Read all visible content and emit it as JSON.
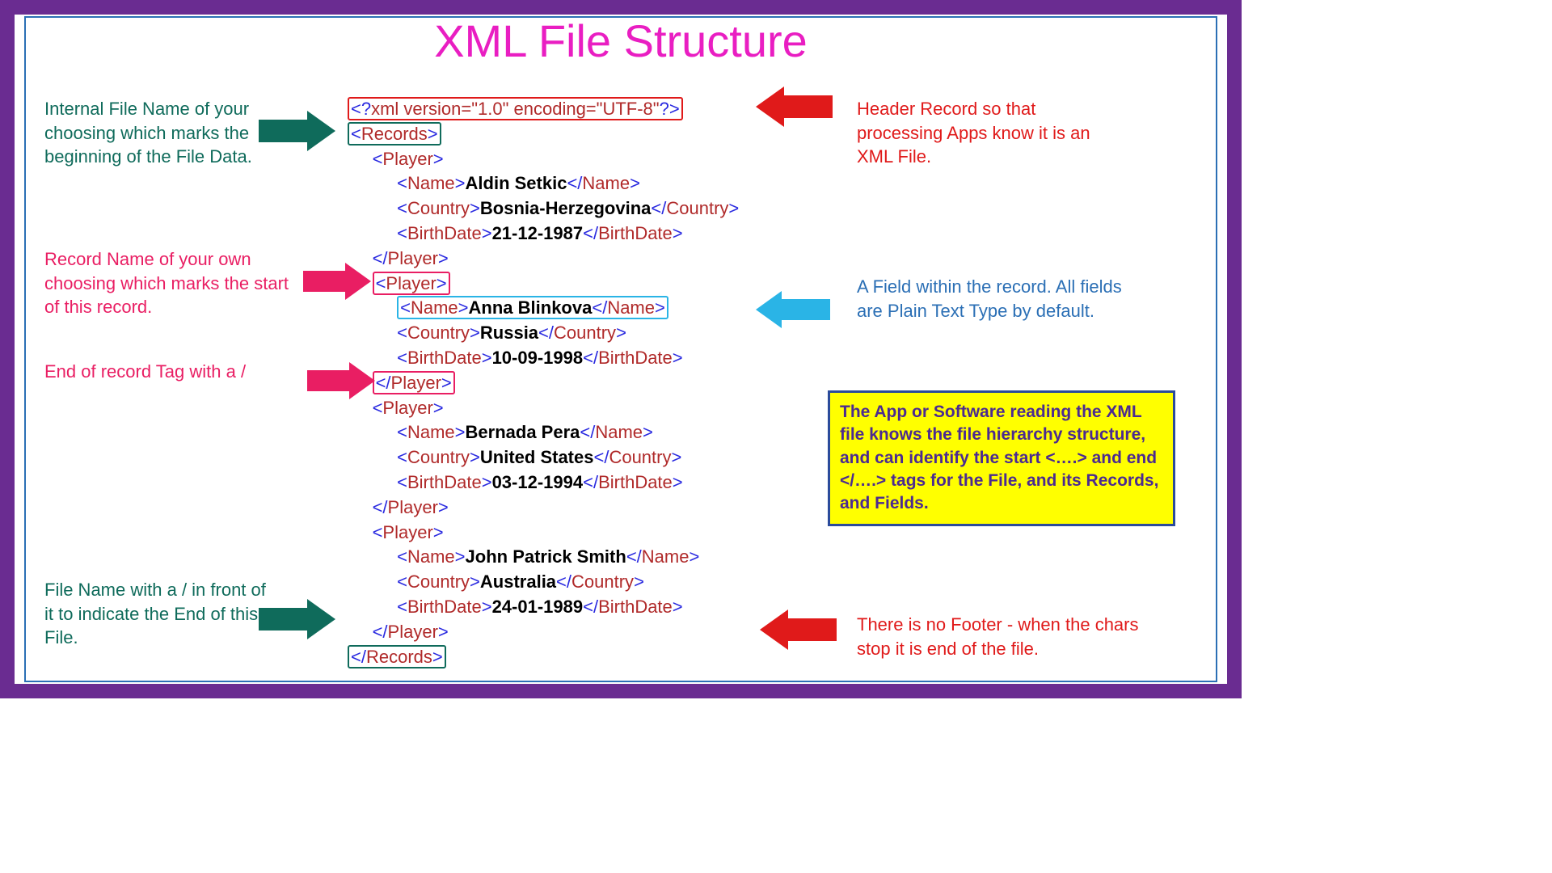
{
  "title": "XML File Structure",
  "xml": {
    "header": "<?xml version=\"1.0\" encoding=\"UTF-8\"?>",
    "rootOpen": "<Records>",
    "rootClose": "</Records>",
    "playerOpen": "<Player>",
    "playerClose": "</Player>",
    "nameOpen": "<Name>",
    "nameClose": "</Name>",
    "countryOpen": "<Country>",
    "countryClose": "</Country>",
    "birthOpen": "<BirthDate>",
    "birthClose": "</BirthDate>",
    "players": [
      {
        "name": "Aldin Setkic",
        "country": "Bosnia-Herzegovina",
        "birth": "21-12-1987"
      },
      {
        "name": "Anna Blinkova",
        "country": "Russia",
        "birth": "10-09-1998"
      },
      {
        "name": "Bernada Pera",
        "country": "United States",
        "birth": "03-12-1994"
      },
      {
        "name": "John Patrick Smith",
        "country": "Australia",
        "birth": "24-01-1989"
      }
    ]
  },
  "ann": {
    "fileName": "Internal File Name of your choosing which marks the beginning of the File Data.",
    "header": "Header Record so that processing Apps know it is an XML File.",
    "recordName": "Record Name of your own choosing which marks the start of this record.",
    "field": "A Field within the record. All fields are Plain Text Type by default.",
    "endRecord": "End of record Tag with a /",
    "endFile": "File Name with a / in front of it to indicate the End of this File.",
    "noFooter": "There is no Footer - when the chars stop it is end of the file."
  },
  "note": "The App or Software reading the XML file knows the file hierarchy structure, and can identify the start <….> and end </….> tags for the File, and its Records, and Fields."
}
